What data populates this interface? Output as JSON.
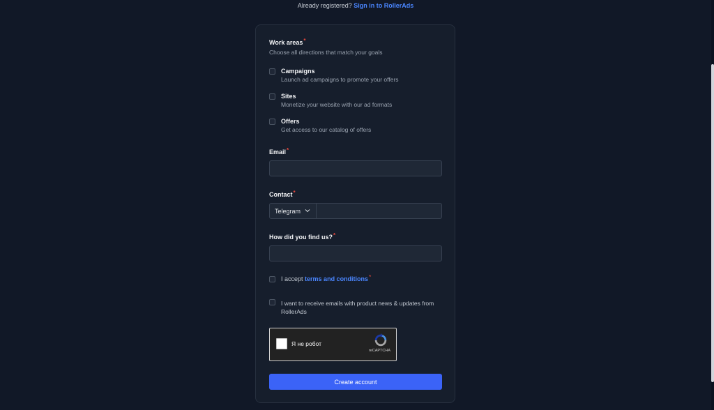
{
  "header": {
    "already_text": "Already registered?",
    "signin_link": "Sign in to RollerAds"
  },
  "work_areas": {
    "title": "Work areas",
    "required_mark": "*",
    "subtitle": "Choose all directions that match your goals",
    "options": [
      {
        "title": "Campaigns",
        "desc": "Launch ad campaigns to promote your offers"
      },
      {
        "title": "Sites",
        "desc": "Monetize your website with our ad formats"
      },
      {
        "title": "Offers",
        "desc": "Get access to our catalog of offers"
      }
    ]
  },
  "email": {
    "label": "Email",
    "value": "",
    "placeholder": ""
  },
  "contact": {
    "label": "Contact",
    "method_selected": "Telegram",
    "value": "",
    "placeholder": ""
  },
  "how_found": {
    "label": "How did you find us?",
    "value": "",
    "placeholder": ""
  },
  "terms": {
    "prefix": "I accept",
    "link": "terms and conditions"
  },
  "newsletter": {
    "line1": "I want to receive emails with product news & updates from",
    "line2": "RollerAds"
  },
  "captcha": {
    "label": "Я не робот",
    "brand": "reCAPTCHA"
  },
  "submit": {
    "label": "Create account"
  },
  "colors": {
    "background": "#111827",
    "card": "#161e2c",
    "accent": "#3b63f7",
    "link": "#4a86ff",
    "required": "#f04a3e"
  },
  "icons": {
    "dropdown": "chevron-down-icon",
    "captcha": "recaptcha-icon"
  }
}
